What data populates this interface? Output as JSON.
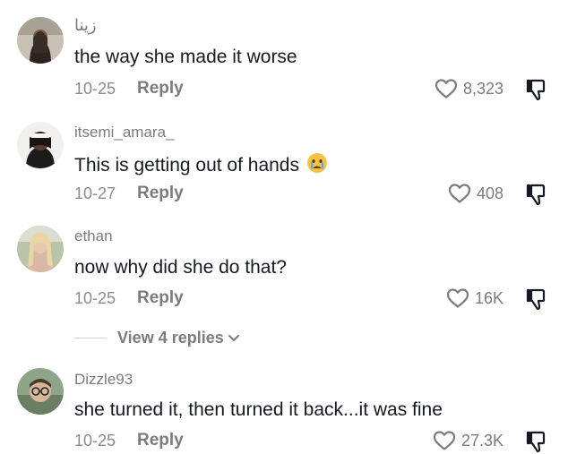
{
  "comments": [
    {
      "username": "زينا",
      "text": "the way she made it worse",
      "date": "10-25",
      "reply_label": "Reply",
      "likes": "8,323",
      "avatar_icon": "avatar-dark-hair"
    },
    {
      "username": "itsemi_amara_",
      "text": "This is getting out of hands",
      "emoji": "crying-face-emoji",
      "date": "10-27",
      "reply_label": "Reply",
      "likes": "408",
      "avatar_icon": "avatar-headband"
    },
    {
      "username": "ethan",
      "text": "now why did she do that?",
      "date": "10-25",
      "reply_label": "Reply",
      "likes": "16K",
      "avatar_icon": "avatar-blonde"
    },
    {
      "username": "Dizzle93",
      "text": "she turned it, then turned it back...it was fine",
      "date": "10-25",
      "reply_label": "Reply",
      "likes": "27.3K",
      "avatar_icon": "avatar-glasses"
    }
  ],
  "view_replies": {
    "label": "View 4 replies",
    "icon": "chevron-down-icon"
  },
  "colors": {
    "text_primary": "#161823",
    "text_secondary": "#7b7b80",
    "background": "#ffffff"
  }
}
